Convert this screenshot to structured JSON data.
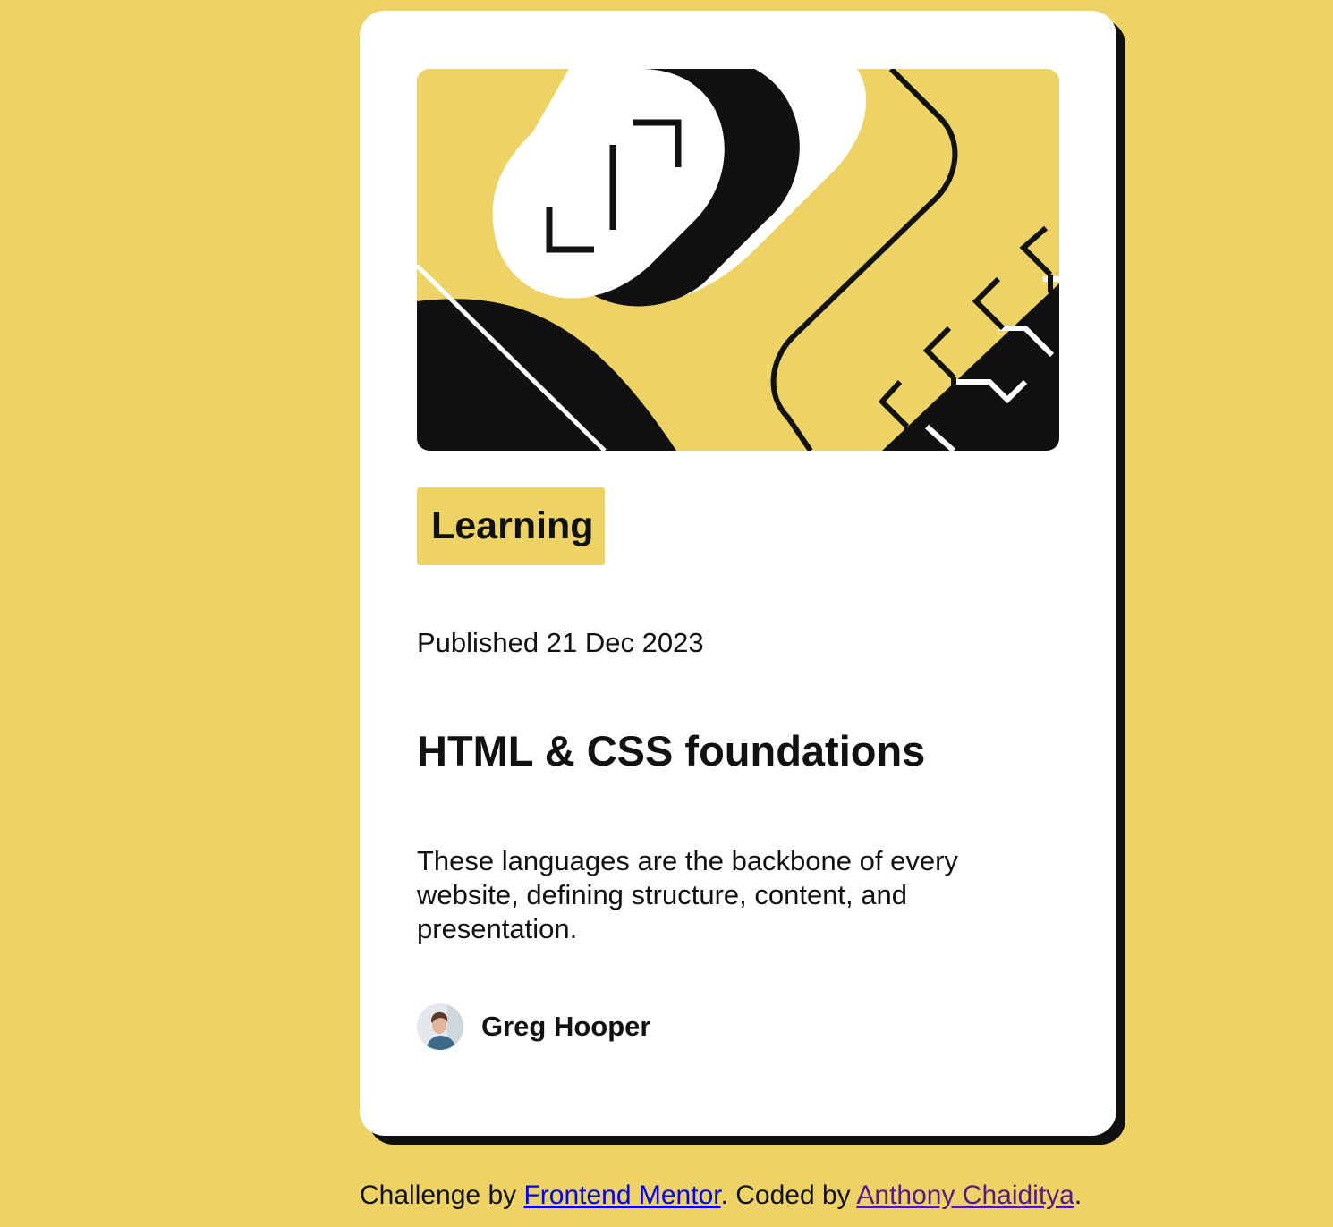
{
  "card": {
    "hero_alt": "illustration-article",
    "tag": "Learning",
    "published": "Published 21 Dec 2023",
    "title": "HTML & CSS foundations",
    "description": "These languages are the backbone of every website, defining structure, content, and presentation.",
    "author": {
      "name": "Greg Hooper",
      "avatar_icon": "avatar-photo"
    }
  },
  "attribution": {
    "prefix": "Challenge by ",
    "link1": "Frontend Mentor",
    "middle": ". Coded by ",
    "link2": "Anthony Chaiditya",
    "suffix": "."
  },
  "colors": {
    "background": "#EDD266",
    "card": "#FFFFFF",
    "text": "#111111",
    "shadow": "#111111",
    "link": "#0000EE",
    "visited_link": "#551A8B"
  }
}
